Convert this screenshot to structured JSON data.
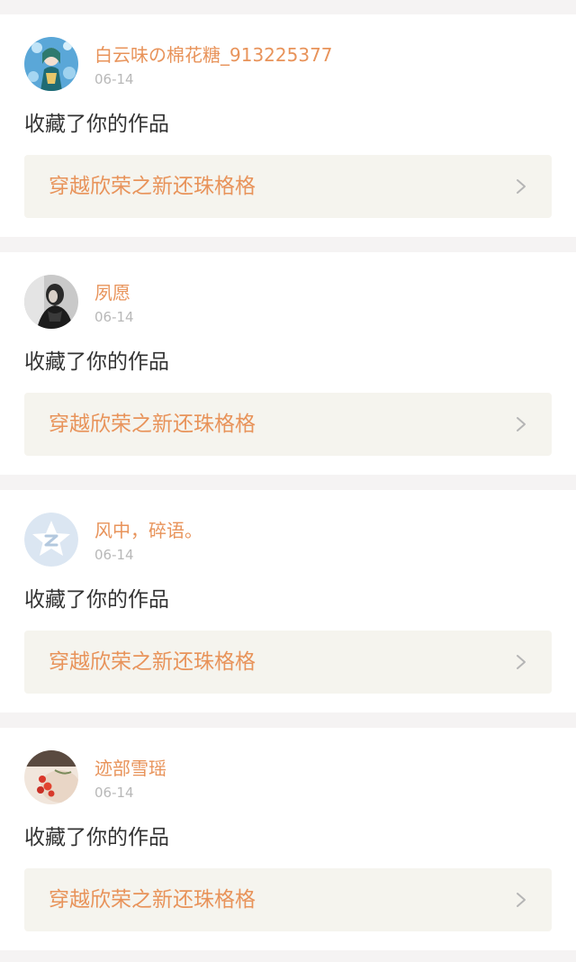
{
  "notifications": [
    {
      "username": "白云味の棉花糖_913225377",
      "date": "06-14",
      "action": "收藏了你的作品",
      "work_title": "穿越欣荣之新还珠格格",
      "avatar_icon": "anime-girl-avatar"
    },
    {
      "username": "夙愿",
      "date": "06-14",
      "action": "收藏了你的作品",
      "work_title": "穿越欣荣之新还珠格格",
      "avatar_icon": "dark-figure-avatar"
    },
    {
      "username": "风中，碎语。",
      "date": "06-14",
      "action": "收藏了你的作品",
      "work_title": "穿越欣荣之新还珠格格",
      "avatar_icon": "qzone-star-avatar"
    },
    {
      "username": "迹部雪瑶",
      "date": "06-14",
      "action": "收藏了你的作品",
      "work_title": "穿越欣荣之新还珠格格",
      "avatar_icon": "photo-avatar"
    }
  ],
  "colors": {
    "accent": "#e8935a",
    "background": "#f5f3f3",
    "card": "#ffffff",
    "link_bg": "#f5f4ee"
  }
}
